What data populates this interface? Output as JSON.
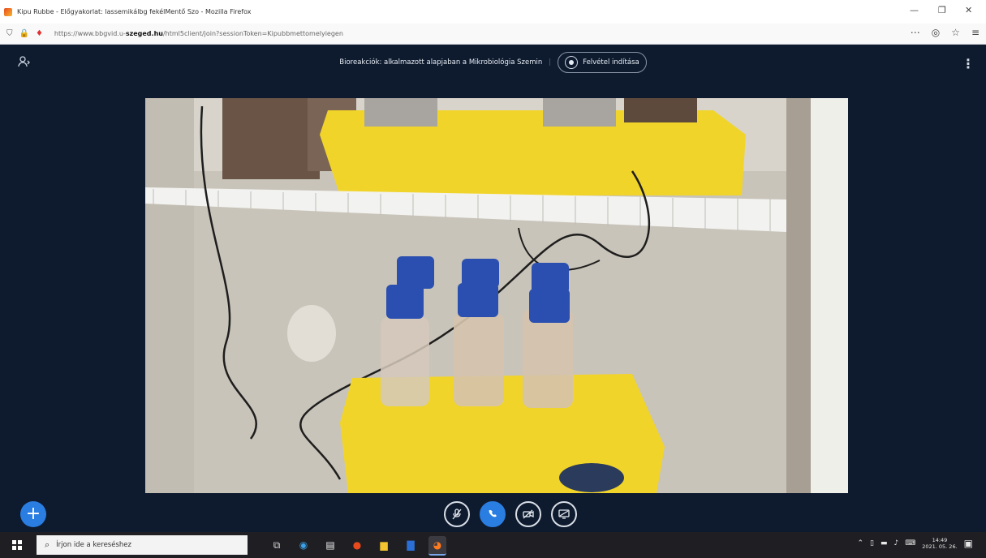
{
  "browser": {
    "window_title": "Kipu Rubbe - Előgyakorlat: lassemikálbg fekélMentő Szo - Mozilla Firefox",
    "url_prefix": "https://www.bbgvid.u-",
    "url_domain": "szeged.hu",
    "url_rest": "/html5client/join?sessionToken=Kipubbmettomelyiegen"
  },
  "meeting": {
    "title": "Bioreakciók: alkalmazott alapjaban a Mikrobiológia Szemin",
    "record_label": "Felvétel indítása"
  },
  "icons": {
    "users": "users-icon",
    "menu": "kebab-menu-icon",
    "mic": "mic-muted-icon",
    "phone": "phone-icon",
    "camera": "camera-off-icon",
    "screen": "screen-share-icon"
  },
  "taskbar": {
    "search_placeholder": "Írjon ide a kereséshez",
    "time": "14:49",
    "date": "2021. 05. 26."
  }
}
